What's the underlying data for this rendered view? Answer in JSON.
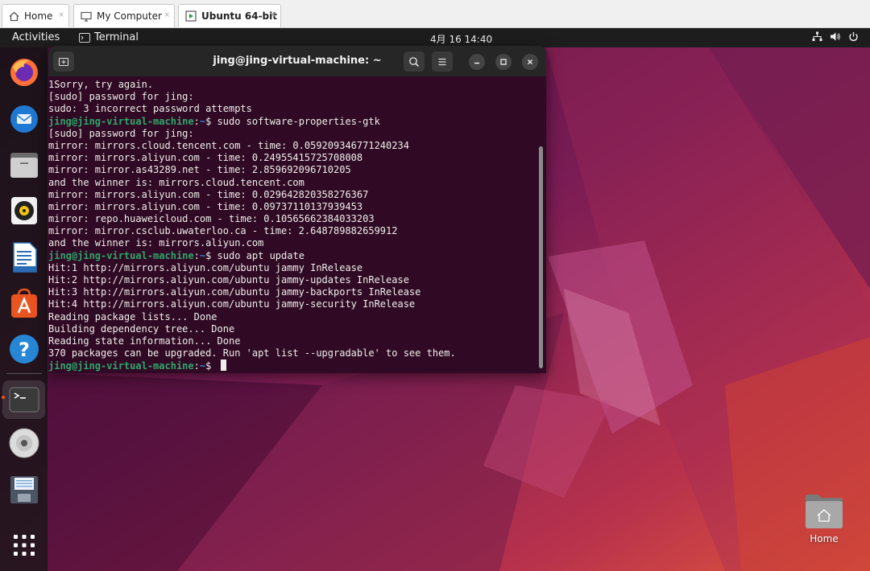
{
  "vm_tabs": [
    {
      "label": "Home",
      "icon": "home-icon"
    },
    {
      "label": "My Computer",
      "icon": "monitor-icon"
    },
    {
      "label": "Ubuntu 64-bit",
      "icon": "vm-run-icon",
      "active": true
    }
  ],
  "top_panel": {
    "activities": "Activities",
    "app_name": "Terminal",
    "clock": "4月 16  14:40",
    "tray_icons": [
      "network-icon",
      "volume-icon",
      "power-icon"
    ]
  },
  "dock": {
    "apps": [
      "firefox-icon",
      "thunderbird-icon",
      "files-icon",
      "rhythmbox-icon",
      "libreoffice-writer-icon",
      "app-center-icon",
      "help-icon",
      "terminal-icon",
      "dvd-icon",
      "floppy-icon",
      "show-apps-grid-icon"
    ],
    "running": "terminal-icon"
  },
  "terminal": {
    "title": "jing@jing-virtual-machine: ~",
    "prompt_user": "jing@jing-virtual-machine",
    "prompt_path": "~",
    "lines": [
      {
        "text": "1Sorry, try again."
      },
      {
        "text": "[sudo] password for jing:"
      },
      {
        "text": "sudo: 3 incorrect password attempts"
      },
      {
        "prompt": true,
        "text": "sudo software-properties-gtk"
      },
      {
        "text": "[sudo] password for jing:"
      },
      {
        "text": "mirror: mirrors.cloud.tencent.com - time: 0.059209346771240234"
      },
      {
        "text": "mirror: mirrors.aliyun.com - time: 0.24955415725708008"
      },
      {
        "text": "mirror: mirror.as43289.net - time: 2.859692096710205"
      },
      {
        "text": "and the winner is: mirrors.cloud.tencent.com"
      },
      {
        "text": "mirror: mirrors.aliyun.com - time: 0.029642820358276367"
      },
      {
        "text": "mirror: mirrors.aliyun.com - time: 0.09737110137939453"
      },
      {
        "text": "mirror: repo.huaweicloud.com - time: 0.10565662384033203"
      },
      {
        "text": "mirror: mirror.csclub.uwaterloo.ca - time: 2.648789882659912"
      },
      {
        "text": "and the winner is: mirrors.aliyun.com"
      },
      {
        "prompt": true,
        "text": "sudo apt update"
      },
      {
        "text": "Hit:1 http://mirrors.aliyun.com/ubuntu jammy InRelease"
      },
      {
        "text": "Hit:2 http://mirrors.aliyun.com/ubuntu jammy-updates InRelease"
      },
      {
        "text": "Hit:3 http://mirrors.aliyun.com/ubuntu jammy-backports InRelease"
      },
      {
        "text": "Hit:4 http://mirrors.aliyun.com/ubuntu jammy-security InRelease"
      },
      {
        "text": "Reading package lists... Done"
      },
      {
        "text": "Building dependency tree... Done"
      },
      {
        "text": "Reading state information... Done"
      },
      {
        "text": "370 packages can be upgraded. Run 'apt list --upgradable' to see them."
      },
      {
        "prompt": true,
        "text": "",
        "cursor": true
      }
    ]
  },
  "desktop": {
    "home_label": "Home"
  }
}
